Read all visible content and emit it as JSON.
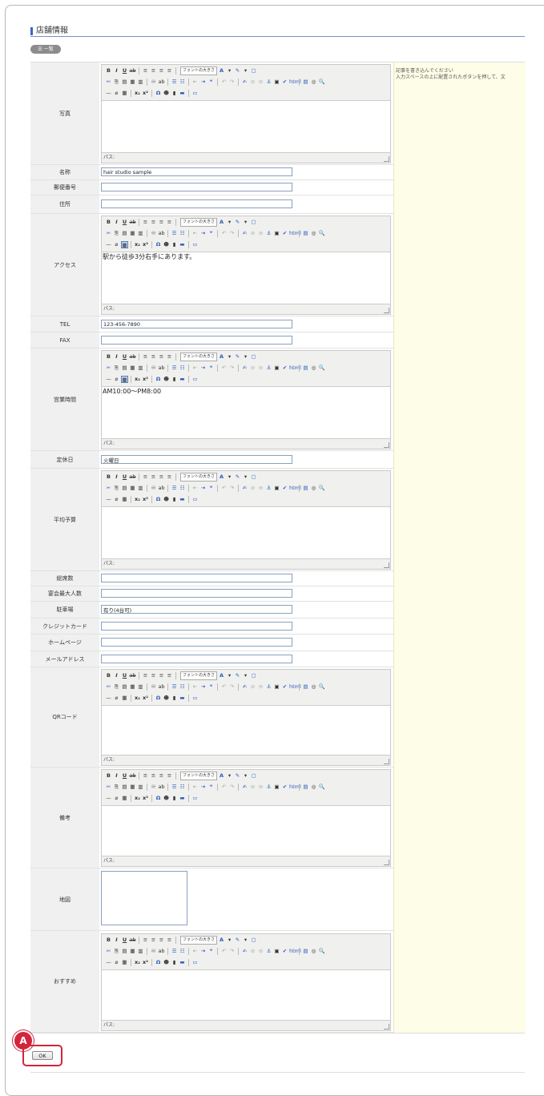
{
  "page": {
    "section_title": "店舗情報",
    "list_button": "一覧",
    "ok_label": "OK",
    "marker": "A"
  },
  "help": {
    "line1": "記事を書き込んでください",
    "line2": "入力スペースの上に配置されたボタンを押して、文"
  },
  "editor": {
    "font_size_label": "フォントの大きさ",
    "status_label": "パス:"
  },
  "fields": {
    "photo": {
      "label": "写真"
    },
    "name": {
      "label": "名称",
      "value": "hair studio sample"
    },
    "postal": {
      "label": "郵便番号",
      "value": ""
    },
    "address": {
      "label": "住所",
      "value": ""
    },
    "access": {
      "label": "アクセス",
      "content": "駅から徒歩3分右手にあります。"
    },
    "tel": {
      "label": "TEL",
      "value": "123-456-7890"
    },
    "fax": {
      "label": "FAX",
      "value": ""
    },
    "hours": {
      "label": "営業時間",
      "content": "AM10:00〜PM8:00"
    },
    "holiday": {
      "label": "定休日",
      "value": "火曜日"
    },
    "budget": {
      "label": "平均予算",
      "content": ""
    },
    "seats": {
      "label": "総席数",
      "value": ""
    },
    "party": {
      "label": "宴会最大人数",
      "value": ""
    },
    "parking": {
      "label": "駐車場",
      "value": "有り(4台可)"
    },
    "credit": {
      "label": "クレジットカード",
      "value": ""
    },
    "homepage": {
      "label": "ホームページ",
      "value": ""
    },
    "email": {
      "label": "メールアドレス",
      "value": ""
    },
    "qr": {
      "label": "QRコード",
      "content": ""
    },
    "remarks": {
      "label": "備考",
      "content": ""
    },
    "map": {
      "label": "地図",
      "value": ""
    },
    "recommend": {
      "label": "おすすめ",
      "content": ""
    }
  }
}
